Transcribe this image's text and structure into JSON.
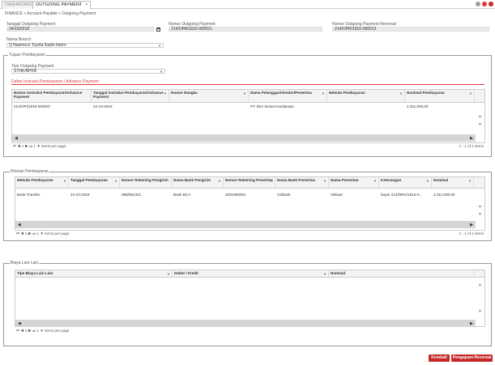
{
  "tabs": [
    {
      "label": "DASHBOARD"
    },
    {
      "label": "OUTGOING PAYMENT"
    }
  ],
  "close_tab": "×",
  "breadcrumb": "FINANCE > Account Payable > Outgoing Payment",
  "form": {
    "tanggal_label": "Tanggal Outgoing Payment",
    "tanggal_value": "24/10/2018",
    "nomor_label": "Nomor Outgoing Payment",
    "nomor_value": "214/OPA/1810-000021",
    "nomor_reversal_label": "Nomor Outgoing Payment Reversal",
    "nomor_reversal_value": "214/OPR/1810-000013",
    "branch_label": "Nama Branch",
    "branch_value": "Nasmoco Toyota Kadin Intern",
    "branch_search_icon": "Q"
  },
  "tujuan": {
    "title": "Tujuan Pembayaran",
    "tipe_label": "Tipe Outgoing Payment",
    "tipe_value": "STNK/BPKB",
    "daftar_title": "Daftar Instruksi Pembayaran / Advance Payment",
    "columns": [
      "Nomor Instruksi Pembayaran/Advance Payment",
      "Tanggal Instruksi Pembayaran/Advance Payment",
      "Nomor Rangka",
      "Nama Pelanggan/Vendor/Penerima",
      "Metoda Pembayaran",
      "Nominal Pembayaran"
    ],
    "rows": [
      [
        "214/OPI/1810-000007",
        "24-10-2018",
        "",
        "PT. Biro Sewai Kendaraan",
        "",
        "2.311.000,00"
      ]
    ],
    "pager": {
      "first": "⏮",
      "prev": "◀",
      "page": "1",
      "next": "▶",
      "last": "⏭",
      "size": "1",
      "per_page": "items per page",
      "info": "1 - 1 of 1 items"
    }
  },
  "rincian": {
    "title": "Rincian Pembayaran",
    "columns": [
      "Metoda Pembayaran",
      "Tanggal Pembayaran",
      "Nomor Rekening Pengirim",
      "Nama Bank Pengirim",
      "Nomor Rekening Penerima",
      "Nama Bank Penerima",
      "Nama Penerima",
      "Keterangan",
      "Nominal"
    ],
    "rows": [
      [
        "Bank Transfer",
        "24-10-2018",
        "098/654321",
        "Bank BCA",
        "2001990001",
        "Citibank",
        "Obisart",
        "bayar 214/NRG/1810-0...",
        "2.311.000,00"
      ]
    ],
    "pager": {
      "first": "⏮",
      "prev": "◀",
      "page": "1",
      "next": "▶",
      "last": "⏭",
      "size": "1",
      "per_page": "items per page",
      "info": "1 - 1 of 1 items"
    }
  },
  "biaya": {
    "title": "Biaya Lain Lain",
    "columns": [
      "Tipe Biaya Lain Lain",
      "Debet / Kredit",
      "Nominal"
    ],
    "pager": {
      "first": "⏮",
      "prev": "◀",
      "page": "0",
      "next": "▶",
      "last": "⏭",
      "size": "1",
      "per_page": "items per page"
    }
  },
  "buttons": {
    "kembali": "Kembali",
    "pengajuan": "Pengajuan Reversal"
  },
  "colors": {
    "accent": "#c62828",
    "redline": "#e53935"
  }
}
